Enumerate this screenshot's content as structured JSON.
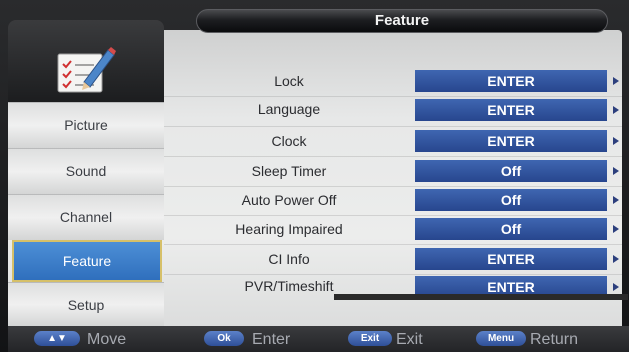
{
  "header": {
    "title": "Feature"
  },
  "sidebar": {
    "logo_icon": "checklist-pencil-icon",
    "items": [
      {
        "label": "Picture"
      },
      {
        "label": "Sound"
      },
      {
        "label": "Channel"
      },
      {
        "label": "Feature",
        "active": true
      },
      {
        "label": "Setup"
      }
    ]
  },
  "menu": {
    "rows": [
      {
        "label": "Lock",
        "value": "ENTER"
      },
      {
        "label": "Language",
        "value": "ENTER"
      },
      {
        "label": "Clock",
        "value": "ENTER"
      },
      {
        "label": "Sleep Timer",
        "value": "Off"
      },
      {
        "label": "Auto Power Off",
        "value": "Off"
      },
      {
        "label": "Hearing Impaired",
        "value": "Off"
      },
      {
        "label": "CI Info",
        "value": "ENTER"
      },
      {
        "label": "PVR/Timeshift",
        "value": "ENTER"
      }
    ],
    "arrow_icon": "triangle-right-icon"
  },
  "footer": {
    "keys": [
      {
        "key": "▲▼",
        "label": "Move"
      },
      {
        "key": "Ok",
        "label": "Enter"
      },
      {
        "key": "Exit",
        "label": "Exit"
      },
      {
        "key": "Menu",
        "label": "Return"
      }
    ]
  },
  "colors": {
    "accent_blue": "#2f6fbd",
    "value_box": "#27468e",
    "highlight_border": "#d6c069"
  }
}
